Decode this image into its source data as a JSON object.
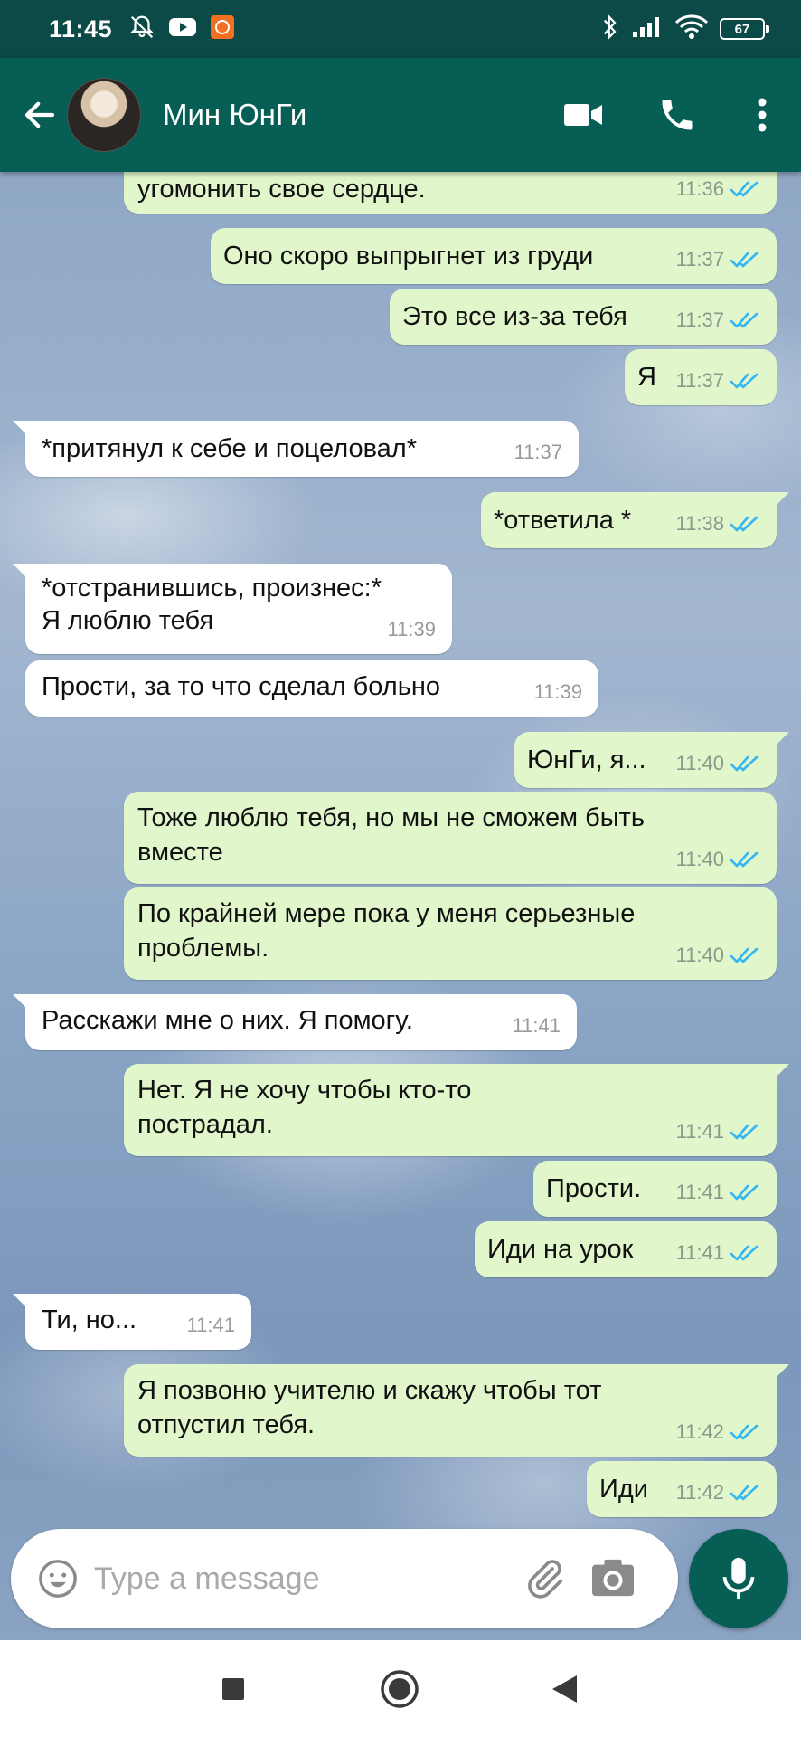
{
  "status_bar": {
    "time": "11:45",
    "battery": "67"
  },
  "header": {
    "contact_name": "Мин ЮнГи"
  },
  "colors": {
    "header": "#075e54",
    "status_bar": "#0c4a47",
    "outgoing_bubble": "#e1f6cb",
    "incoming_bubble": "#ffffff",
    "read_ticks": "#34b7f1"
  },
  "messages": [
    {
      "dir": "out",
      "lines": [
        "угомонить свое сердце."
      ],
      "time": "11:36"
    },
    {
      "dir": "out",
      "lines": [
        "Оно скоро выпрыгнет из груди"
      ],
      "time": "11:37"
    },
    {
      "dir": "out",
      "lines": [
        "Это все из-за тебя"
      ],
      "time": "11:37"
    },
    {
      "dir": "out",
      "lines": [
        "Я"
      ],
      "time": "11:37"
    },
    {
      "dir": "in",
      "lines": [
        "*притянул к себе и поцеловал*"
      ],
      "time": "11:37"
    },
    {
      "dir": "out",
      "lines": [
        "*ответила *"
      ],
      "time": "11:38"
    },
    {
      "dir": "in",
      "lines": [
        "*отстранившись, произнес:*",
        "Я люблю тебя"
      ],
      "time": "11:39"
    },
    {
      "dir": "in",
      "lines": [
        "Прости, за то что сделал больно"
      ],
      "time": "11:39"
    },
    {
      "dir": "out",
      "lines": [
        "ЮнГи, я..."
      ],
      "time": "11:40"
    },
    {
      "dir": "out",
      "lines": [
        "Тоже люблю тебя, но мы не сможем быть",
        "вместе"
      ],
      "time": "11:40"
    },
    {
      "dir": "out",
      "lines": [
        "По крайней мере пока у меня серьезные",
        "проблемы."
      ],
      "time": "11:40"
    },
    {
      "dir": "in",
      "lines": [
        "Расскажи мне о них. Я помогу."
      ],
      "time": "11:41"
    },
    {
      "dir": "out",
      "lines": [
        "Нет. Я не хочу чтобы кто-то",
        "пострадал."
      ],
      "time": "11:41"
    },
    {
      "dir": "out",
      "lines": [
        "Прости."
      ],
      "time": "11:41"
    },
    {
      "dir": "out",
      "lines": [
        "Иди на урок"
      ],
      "time": "11:41"
    },
    {
      "dir": "in",
      "lines": [
        "Ти, но..."
      ],
      "time": "11:41"
    },
    {
      "dir": "out",
      "lines": [
        "Я позвоню учителю и скажу чтобы тот",
        "отпустил тебя."
      ],
      "time": "11:42"
    },
    {
      "dir": "out",
      "lines": [
        "Иди"
      ],
      "time": "11:42"
    }
  ],
  "composer": {
    "placeholder": "Type a message"
  }
}
